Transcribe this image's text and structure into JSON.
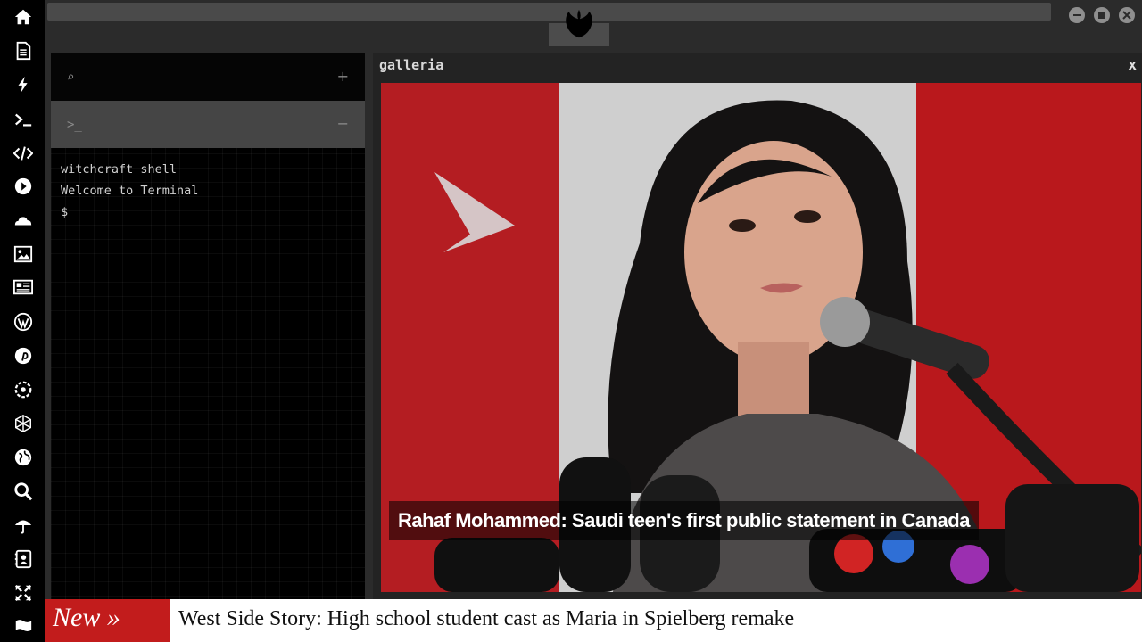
{
  "dock": {
    "icons": [
      "home-icon",
      "document-icon",
      "lightning-icon",
      "terminal-icon",
      "code-icon",
      "play-icon",
      "cloud-icon",
      "image-icon",
      "news-icon",
      "wordpress-icon",
      "pinterest-icon",
      "settings-icon",
      "network-icon",
      "globe-icon",
      "search-icon",
      "umbrella-icon",
      "contacts-icon",
      "fullscreen-icon",
      "flag-icon"
    ]
  },
  "window": {
    "controls": [
      "minimize",
      "maximize",
      "close"
    ]
  },
  "terminal": {
    "search_icon": "⌕",
    "add_label": "+",
    "prompt_icon": ">_",
    "collapse_label": "−",
    "lines": [
      "witchcraft shell",
      "Welcome to Terminal",
      "$"
    ]
  },
  "gallery": {
    "title": "galleria",
    "close_label": "x",
    "caption": "Rahaf Mohammed: Saudi teen's first public statement in Canada"
  },
  "ticker": {
    "badge": "New »",
    "headline": "West Side Story: High school student cast as Maria in Spielberg remake"
  },
  "colors": {
    "dock_bg": "#000000",
    "panel_bg": "#2b2b2b",
    "ticker_badge": "#c21c1c",
    "flag_red": "#b41d22"
  }
}
